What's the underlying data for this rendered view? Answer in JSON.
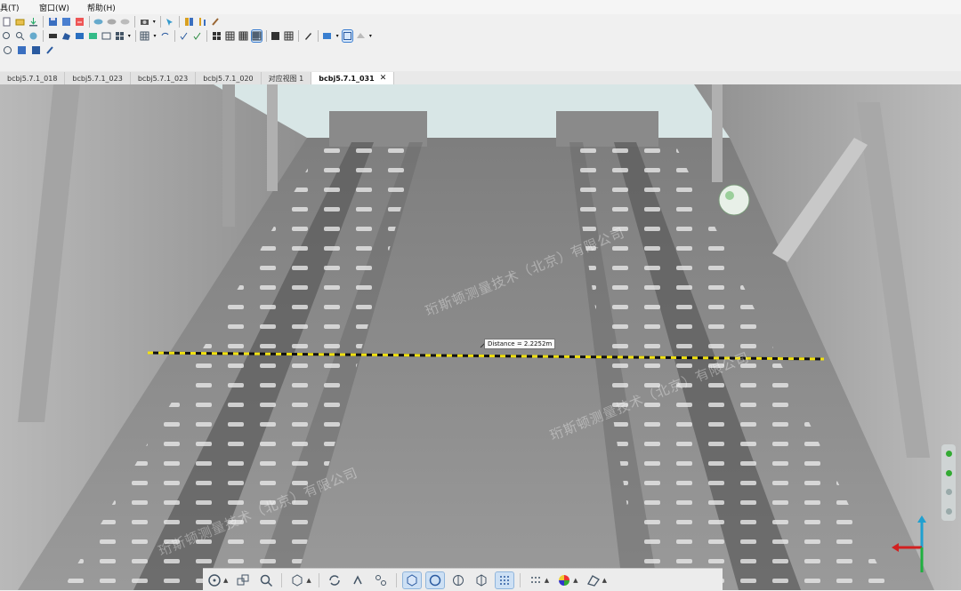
{
  "menu": {
    "items": [
      "具(T)",
      "窗口(W)",
      "帮助(H)"
    ]
  },
  "tabs": [
    {
      "label": "bcbj5.7.1_018",
      "active": false
    },
    {
      "label": "bcbj5.7.1_023",
      "active": false
    },
    {
      "label": "bcbj5.7.1_023",
      "active": false
    },
    {
      "label": "bcbj5.7.1_020",
      "active": false
    },
    {
      "label": "对应视图 1",
      "active": false
    },
    {
      "label": "bcbj5.7.1_031",
      "active": true
    }
  ],
  "viewport": {
    "measurement_label": "Distance = 2.2252m",
    "watermarks": [
      "珩斯顿测量技术（北京）有限公司",
      "珩斯顿测量技术（北京）有限公司",
      "珩斯顿测量技术（北京）有限公司"
    ]
  },
  "colors": {
    "measure_line_dash": "#f0e010",
    "viewport_bg": "#d8e6e6",
    "axis_x": "#d22020",
    "axis_y": "#20b040",
    "axis_z": "#20a0d0"
  },
  "icons": {
    "tab_close": "✕",
    "caret": "▲"
  }
}
